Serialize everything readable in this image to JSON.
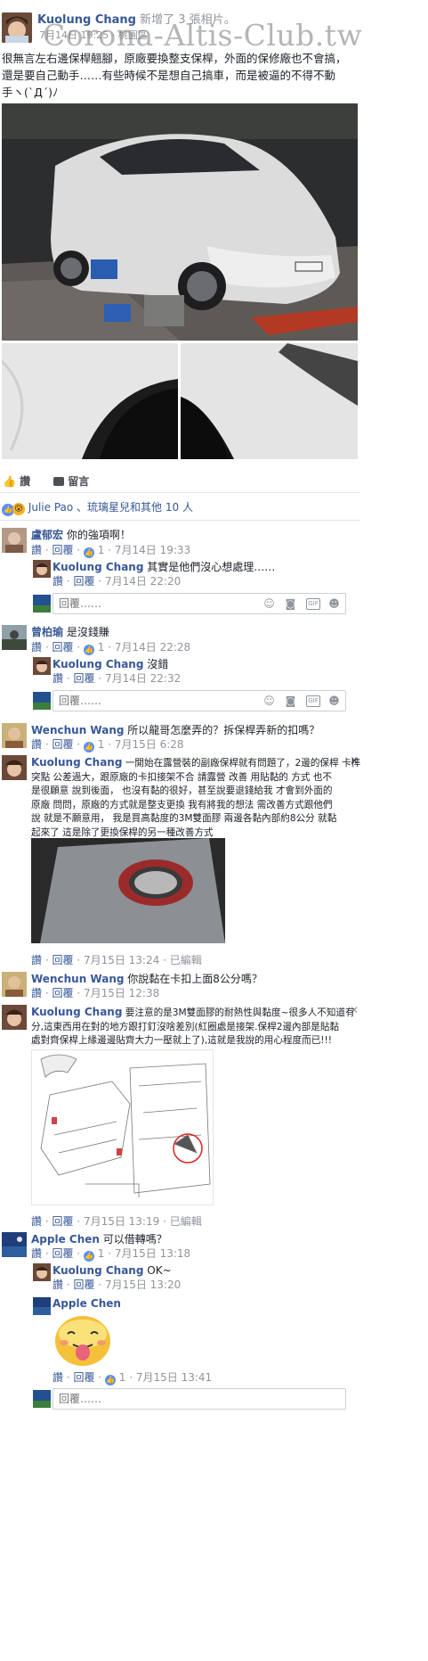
{
  "watermark": "Corona-Altis-Club.tw",
  "post": {
    "author": "Kuolung Chang",
    "action": "新增了 3 張相片。",
    "date": "7月14日 19:25",
    "location": "桃園區",
    "text_lines": [
      "很無言左右邊保桿翹腳，原廠要換整支保桿，外面的保修廠也不會搞，",
      "還是要自己動手……有些時候不是想自己搞車，而是被逼的不得不動",
      "手ヽ(`Д´)ﾉ"
    ]
  },
  "actions": {
    "like": "讚",
    "comment": "留言"
  },
  "reactions": {
    "text": "Julie Pao 、琉璃星兒和其他 10 人"
  },
  "common": {
    "like": "讚",
    "reply": "回覆",
    "edited": "已編輯",
    "reply_placeholder": "回覆……"
  },
  "comments": [
    {
      "author": "盧郁宏",
      "text": "你的強項啊！",
      "likes": "1",
      "date": "7月14日 19:33"
    },
    {
      "author": "Kuolung Chang",
      "text": "其實是他們沒心想處理……",
      "date": "7月14日 22:20"
    },
    {
      "author": "曾柏瑜",
      "text": "是沒錢賺",
      "likes": "1",
      "date": "7月14日 22:28"
    },
    {
      "author": "Kuolung Chang",
      "text": "沒錯",
      "date": "7月14日 22:32"
    },
    {
      "author": "Wenchun Wang",
      "text": "所以龍哥怎麼弄的？拆保桿弄新的扣嗎？",
      "likes": "1",
      "date": "7月15日 6:28"
    },
    {
      "author": "Kuolung Chang",
      "text_lines": [
        "一開始在露營裝的副廠保桿就有問題了，2邊的保桿 卡榫",
        "突點 公差過大，跟原廠的卡扣接架不合 請露營 改善 用貼黏的 方式 也不",
        "是很願意 說到後面， 也沒有黏的很好，甚至說要退錢給我 才會到外面的",
        "原廠 問問，原廠的方式就是整支更換 我有將我的想法 需改善方式跟他們",
        "說 就是不願意用， 我是買高黏度的3M雙面膠 兩邊各黏內部約8公分 就黏",
        "起來了 這是除了更換保桿的另一種改善方式"
      ],
      "date": "7月15日 13:24"
    },
    {
      "author": "Wenchun Wang",
      "text": "你說黏在卡扣上面8公分嗎？",
      "date": "7月15日 12:38"
    },
    {
      "author": "Kuolung Chang",
      "text_lines": [
        "要注意的是3M雙面膠的耐熱性與黏度~很多人不知道有",
        "分,這東西用在對的地方跟打釘沒啥差別(紅圈處是接架.保桿2邊內部是貼黏",
        "處對齊保桿上緣邊邊貼齊大力一壓就上了),這就是我說的用心程度而已!!!"
      ],
      "date": "7月15日 13:19"
    },
    {
      "author": "Apple Chen",
      "text": "可以借轉嗎？",
      "likes": "1",
      "date": "7月15日 13:18"
    },
    {
      "author": "Kuolung Chang",
      "text": "OK~",
      "date": "7月15日 13:20"
    },
    {
      "author": "Apple Chen",
      "likes": "1",
      "date": "7月15日 13:41"
    }
  ],
  "colors": {
    "link": "#385898",
    "meta": "#90949c",
    "like_blue": "#5890ff",
    "wow_yellow": "#f7b125"
  }
}
